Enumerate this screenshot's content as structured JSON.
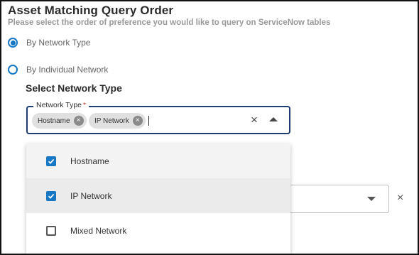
{
  "header": {
    "title": "Asset Matching Query Order",
    "subtitle": "Please select the order of preference you would like to query on ServiceNow tables"
  },
  "radios": [
    {
      "label": "By Network Type",
      "selected": true
    },
    {
      "label": "By Individual Network",
      "selected": false
    }
  ],
  "section_title": "Select Network Type",
  "network_field": {
    "label": "Network Type",
    "required_mark": "*",
    "chips": [
      "Hostname",
      "IP Network"
    ],
    "clear_glyph": "×",
    "chip_remove_glyph": "×"
  },
  "dropdown": {
    "options": [
      {
        "label": "Hostname",
        "checked": true
      },
      {
        "label": "IP Network",
        "checked": true
      },
      {
        "label": "Mixed Network",
        "checked": false
      }
    ]
  },
  "background_row": {
    "clear_glyph": "×"
  },
  "colors": {
    "accent": "#1677c5",
    "field_border": "#1f3d73",
    "required": "#c0392b"
  }
}
